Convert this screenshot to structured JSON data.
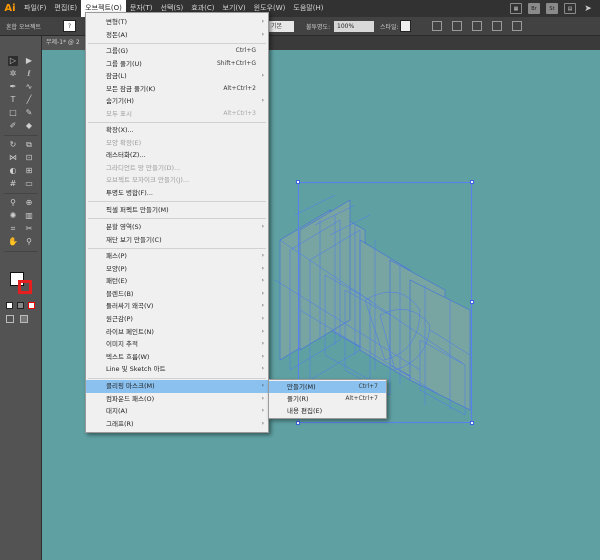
{
  "app": {
    "logo": "Ai"
  },
  "menubar": {
    "items": [
      "파일(F)",
      "편집(E)",
      "오브젝트(O)",
      "문자(T)",
      "선택(S)",
      "효과(C)",
      "보기(V)",
      "윈도우(W)",
      "도움말(H)"
    ],
    "right_icons": [
      "grid-icon",
      "bridge-icon",
      "stock-icon",
      "arrange-icon",
      "send-icon"
    ],
    "right_labels": {
      "br": "Br",
      "st": "St"
    }
  },
  "control_bar": {
    "object_label": "혼합 오브젝트",
    "swatch_text": "?",
    "stroke_style": "기본",
    "opacity_label": "불투명도:",
    "opacity_value": "100%",
    "style_label": "스타일:"
  },
  "document": {
    "tab_label": "무제-1* @ 2"
  },
  "tools": [
    "selection-tool",
    "direct-selection-tool",
    "magic-wand-tool",
    "lasso-tool",
    "pen-tool",
    "curvature-tool",
    "type-tool",
    "line-tool",
    "rectangle-tool",
    "paintbrush-tool",
    "shaper-tool",
    "eraser-tool",
    "rotate-tool",
    "scale-tool",
    "width-tool",
    "free-transform-tool",
    "shape-builder-tool",
    "perspective-grid-tool",
    "mesh-tool",
    "gradient-tool",
    "eyedropper-tool",
    "blend-tool",
    "symbol-sprayer-tool",
    "column-graph-tool",
    "artboard-tool",
    "slice-tool",
    "hand-tool",
    "zoom-tool"
  ],
  "object_menu": {
    "items": [
      {
        "label": "변형(T)",
        "shortcut": "",
        "submenu": true,
        "disabled": false
      },
      {
        "label": "정돈(A)",
        "shortcut": "",
        "submenu": true,
        "disabled": false
      },
      {
        "label": "그룹(G)",
        "shortcut": "Ctrl+G",
        "submenu": false,
        "disabled": false
      },
      {
        "label": "그룹 풀기(U)",
        "shortcut": "Shift+Ctrl+G",
        "submenu": false,
        "disabled": false
      },
      {
        "label": "잠금(L)",
        "shortcut": "",
        "submenu": true,
        "disabled": false
      },
      {
        "label": "모든 잠금 풀기(K)",
        "shortcut": "Alt+Ctrl+2",
        "submenu": false,
        "disabled": false
      },
      {
        "label": "숨기기(H)",
        "shortcut": "",
        "submenu": true,
        "disabled": false
      },
      {
        "label": "모두 표시",
        "shortcut": "Alt+Ctrl+3",
        "submenu": false,
        "disabled": true
      },
      {
        "label": "확장(X)...",
        "shortcut": "",
        "submenu": false,
        "disabled": false
      },
      {
        "label": "모양 확장(E)",
        "shortcut": "",
        "submenu": false,
        "disabled": true
      },
      {
        "label": "래스터화(Z)...",
        "shortcut": "",
        "submenu": false,
        "disabled": false
      },
      {
        "label": "그라디언트 망 만들기(D)...",
        "shortcut": "",
        "submenu": false,
        "disabled": true
      },
      {
        "label": "오브젝트 모자이크 만들기(J)...",
        "shortcut": "",
        "submenu": false,
        "disabled": true
      },
      {
        "label": "투명도 병합(F)...",
        "shortcut": "",
        "submenu": false,
        "disabled": false
      },
      {
        "label": "픽셀 퍼펙트 만들기(M)",
        "shortcut": "",
        "submenu": false,
        "disabled": false
      },
      {
        "label": "분할 영역(S)",
        "shortcut": "",
        "submenu": true,
        "disabled": false
      },
      {
        "label": "재단 보기 만들기(C)",
        "shortcut": "",
        "submenu": false,
        "disabled": false
      },
      {
        "label": "패스(P)",
        "shortcut": "",
        "submenu": true,
        "disabled": false
      },
      {
        "label": "모양(P)",
        "shortcut": "",
        "submenu": true,
        "disabled": false
      },
      {
        "label": "패턴(E)",
        "shortcut": "",
        "submenu": true,
        "disabled": false
      },
      {
        "label": "블렌드(B)",
        "shortcut": "",
        "submenu": true,
        "disabled": false
      },
      {
        "label": "둘러싸기 왜곡(V)",
        "shortcut": "",
        "submenu": true,
        "disabled": false
      },
      {
        "label": "원근감(P)",
        "shortcut": "",
        "submenu": true,
        "disabled": false
      },
      {
        "label": "라이브 페인트(N)",
        "shortcut": "",
        "submenu": true,
        "disabled": false
      },
      {
        "label": "이미지 추적",
        "shortcut": "",
        "submenu": true,
        "disabled": false
      },
      {
        "label": "텍스트 흐름(W)",
        "shortcut": "",
        "submenu": true,
        "disabled": false
      },
      {
        "label": "Line 및 Sketch 아트",
        "shortcut": "",
        "submenu": true,
        "disabled": false
      },
      {
        "label": "클리핑 마스크(M)",
        "shortcut": "",
        "submenu": true,
        "disabled": false,
        "highlighted": true
      },
      {
        "label": "컴파운드 패스(O)",
        "shortcut": "",
        "submenu": true,
        "disabled": false
      },
      {
        "label": "대지(A)",
        "shortcut": "",
        "submenu": true,
        "disabled": false
      },
      {
        "label": "그래프(R)",
        "shortcut": "",
        "submenu": true,
        "disabled": false
      }
    ]
  },
  "clipping_submenu": {
    "items": [
      {
        "label": "만들기(M)",
        "shortcut": "Ctrl+7"
      },
      {
        "label": "풀기(R)",
        "shortcut": "Alt+Ctrl+7"
      },
      {
        "label": "내용 편집(E)",
        "shortcut": ""
      }
    ]
  },
  "colors": {
    "canvas": "#5fa1a3",
    "menu_highlight": "#8bc1ef",
    "selection": "#3b64e0",
    "accent": "#ff9a00"
  }
}
